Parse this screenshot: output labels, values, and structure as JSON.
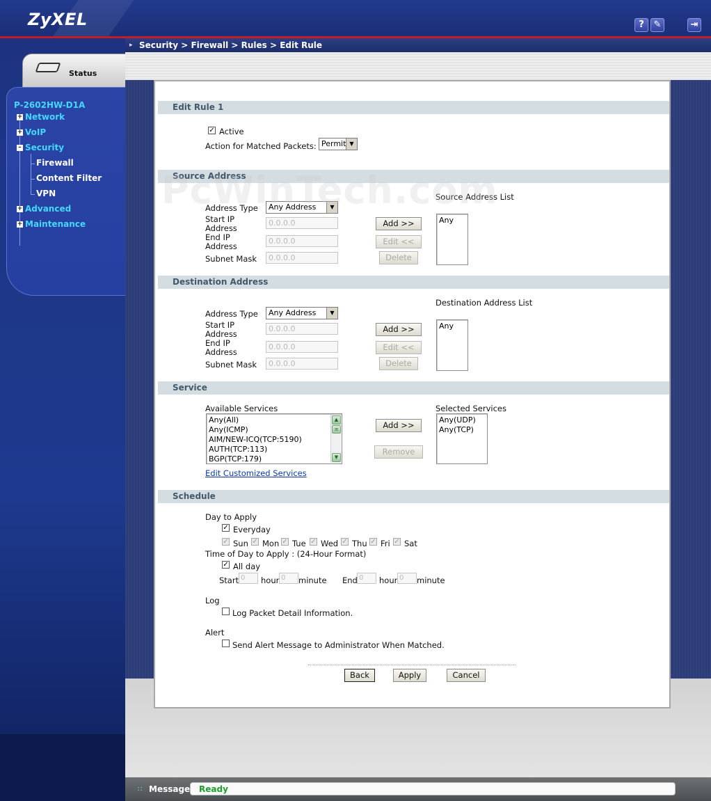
{
  "brand": {
    "logo": "ZyXEL"
  },
  "header_buttons": {
    "help": "?",
    "wizard": "✎",
    "logout": "⇥"
  },
  "breadcrumb": "Security > Firewall > Rules > Edit Rule",
  "sidebar": {
    "status_label": "Status",
    "model": "P-2602HW-D1A",
    "items": [
      {
        "label": "Network",
        "expanded": false
      },
      {
        "label": "VoIP",
        "expanded": false
      },
      {
        "label": "Security",
        "expanded": true,
        "children": [
          "Firewall",
          "Content Filter",
          "VPN"
        ]
      },
      {
        "label": "Advanced",
        "expanded": false
      },
      {
        "label": "Maintenance",
        "expanded": false
      }
    ]
  },
  "watermark": "PcWinTech.com",
  "edit_rule": {
    "title": "Edit Rule 1",
    "active_label": "Active",
    "active_checked": true,
    "action_label": "Action for Matched Packets:",
    "action_value": "Permit"
  },
  "source": {
    "title": "Source Address",
    "address_type_label": "Address Type",
    "address_type_value": "Any Address",
    "start_ip_label": "Start IP Address",
    "start_ip_value": "0.0.0.0",
    "end_ip_label": "End IP Address",
    "end_ip_value": "0.0.0.0",
    "subnet_label": "Subnet Mask",
    "subnet_value": "0.0.0.0",
    "add_btn": "Add >>",
    "edit_btn": "Edit <<",
    "delete_btn": "Delete",
    "list_label": "Source Address List",
    "list": [
      "Any"
    ]
  },
  "destination": {
    "title": "Destination Address",
    "address_type_label": "Address Type",
    "address_type_value": "Any Address",
    "start_ip_label": "Start IP Address",
    "start_ip_value": "0.0.0.0",
    "end_ip_label": "End IP Address",
    "end_ip_value": "0.0.0.0",
    "subnet_label": "Subnet Mask",
    "subnet_value": "0.0.0.0",
    "add_btn": "Add >>",
    "edit_btn": "Edit <<",
    "delete_btn": "Delete",
    "list_label": "Destination Address List",
    "list": [
      "Any"
    ]
  },
  "service": {
    "title": "Service",
    "available_label": "Available Services",
    "available": [
      "Any(All)",
      "Any(ICMP)",
      "AIM/NEW-ICQ(TCP:5190)",
      "AUTH(TCP:113)",
      "BGP(TCP:179)"
    ],
    "selected_label": "Selected Services",
    "selected": [
      "Any(UDP)",
      "Any(TCP)"
    ],
    "add_btn": "Add >>",
    "remove_btn": "Remove",
    "edit_link": "Edit Customized Services"
  },
  "schedule": {
    "title": "Schedule",
    "day_label": "Day to Apply",
    "everyday_label": "Everyday",
    "days": [
      "Sun",
      "Mon",
      "Tue",
      "Wed",
      "Thu",
      "Fri",
      "Sat"
    ],
    "time_label": "Time of Day to Apply : (24-Hour Format)",
    "allday_label": "All day",
    "start_label": "Start",
    "end_label": "End",
    "hour_label": "hour",
    "minute_label": "minute",
    "start_hour": "0",
    "start_minute": "0",
    "end_hour": "0",
    "end_minute": "0"
  },
  "log": {
    "title": "Log",
    "option": "Log Packet Detail Information."
  },
  "alert": {
    "title": "Alert",
    "option": "Send Alert Message to Administrator When Matched."
  },
  "actions": {
    "back": "Back",
    "apply": "Apply",
    "cancel": "Cancel"
  },
  "message": {
    "label": "Message",
    "status": "Ready"
  }
}
